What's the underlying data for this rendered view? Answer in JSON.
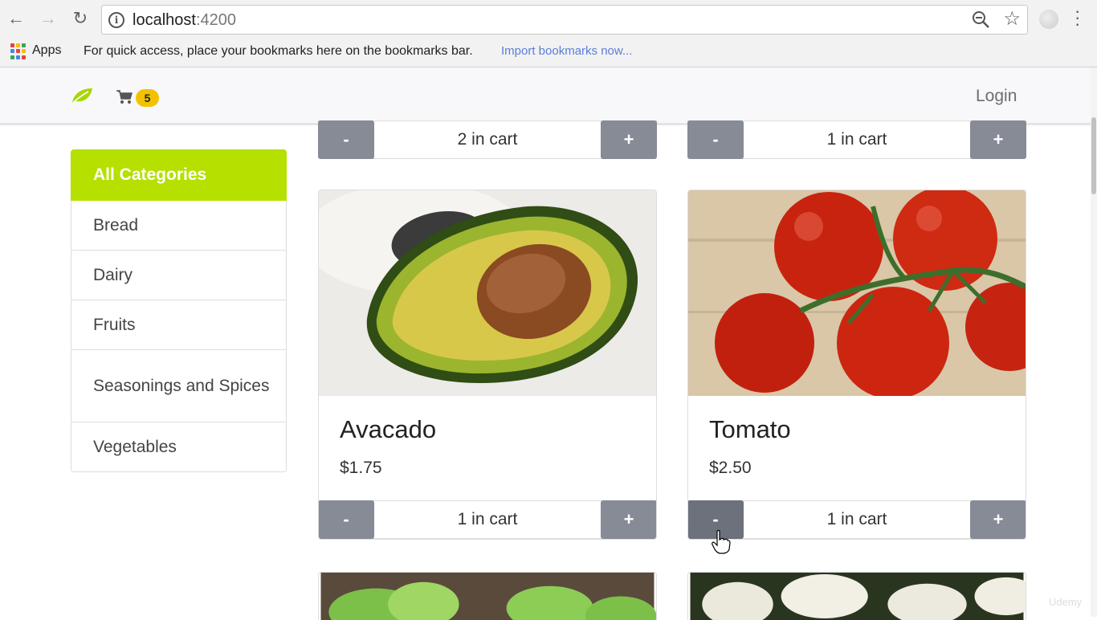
{
  "browser": {
    "url_host": "localhost",
    "url_port": ":4200",
    "info_icon": "i",
    "bookmarks": {
      "apps_label": "Apps",
      "hint": "For quick access, place your bookmarks here on the bookmarks bar.",
      "import_link": "Import bookmarks now..."
    }
  },
  "navbar": {
    "cart_count": "5",
    "login_label": "Login",
    "accent_color": "#b5e000"
  },
  "sidebar": {
    "items": [
      {
        "label": "All Categories",
        "active": true
      },
      {
        "label": "Bread"
      },
      {
        "label": "Dairy"
      },
      {
        "label": "Fruits"
      },
      {
        "label": "Seasonings and Spices"
      },
      {
        "label": "Vegetables"
      }
    ]
  },
  "top_row": [
    {
      "minus": "-",
      "qty": "2 in cart",
      "plus": "+"
    },
    {
      "minus": "-",
      "qty": "1 in cart",
      "plus": "+"
    }
  ],
  "products": [
    {
      "title": "Avacado",
      "price": "$1.75",
      "minus": "-",
      "qty": "1 in cart",
      "plus": "+"
    },
    {
      "title": "Tomato",
      "price": "$2.50",
      "minus": "-",
      "qty": "1 in cart",
      "plus": "+"
    }
  ],
  "watermark": "Udemy"
}
